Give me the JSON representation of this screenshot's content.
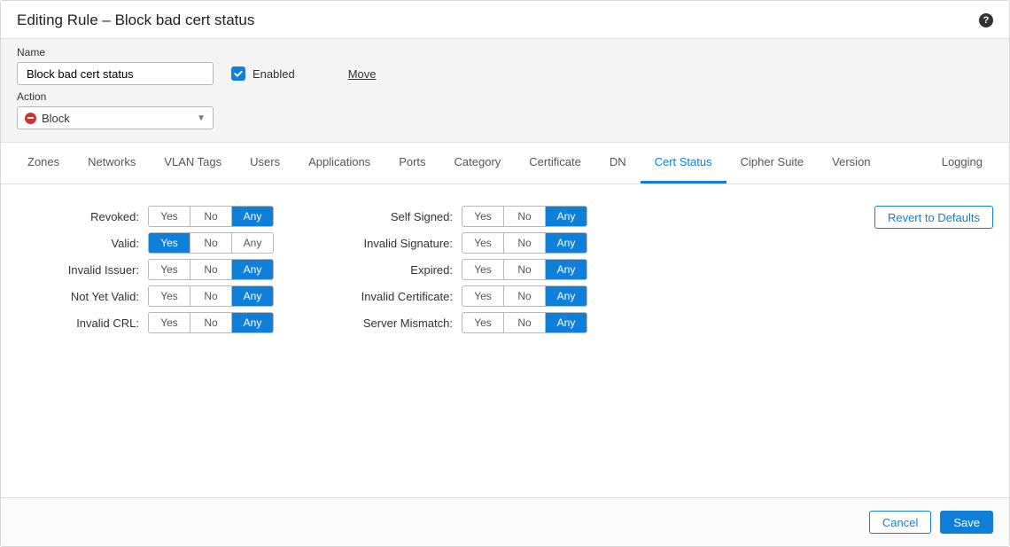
{
  "header": {
    "title": "Editing Rule – Block bad cert status"
  },
  "form": {
    "name_label": "Name",
    "name_value": "Block bad cert status",
    "enabled_label": "Enabled",
    "move_label": "Move",
    "action_label": "Action",
    "action_value": "Block"
  },
  "tabs": [
    "Zones",
    "Networks",
    "VLAN Tags",
    "Users",
    "Applications",
    "Ports",
    "Category",
    "Certificate",
    "DN",
    "Cert Status",
    "Cipher Suite",
    "Version"
  ],
  "tab_right": "Logging",
  "active_tab": "Cert Status",
  "toggle_options": [
    "Yes",
    "No",
    "Any"
  ],
  "status_col1": [
    {
      "label": "Revoked:",
      "selected": "Any"
    },
    {
      "label": "Valid:",
      "selected": "Yes"
    },
    {
      "label": "Invalid Issuer:",
      "selected": "Any"
    },
    {
      "label": "Not Yet Valid:",
      "selected": "Any"
    },
    {
      "label": "Invalid CRL:",
      "selected": "Any"
    }
  ],
  "status_col2": [
    {
      "label": "Self Signed:",
      "selected": "Any"
    },
    {
      "label": "Invalid Signature:",
      "selected": "Any"
    },
    {
      "label": "Expired:",
      "selected": "Any"
    },
    {
      "label": "Invalid Certificate:",
      "selected": "Any"
    },
    {
      "label": "Server Mismatch:",
      "selected": "Any"
    }
  ],
  "buttons": {
    "revert": "Revert to Defaults",
    "cancel": "Cancel",
    "save": "Save"
  }
}
